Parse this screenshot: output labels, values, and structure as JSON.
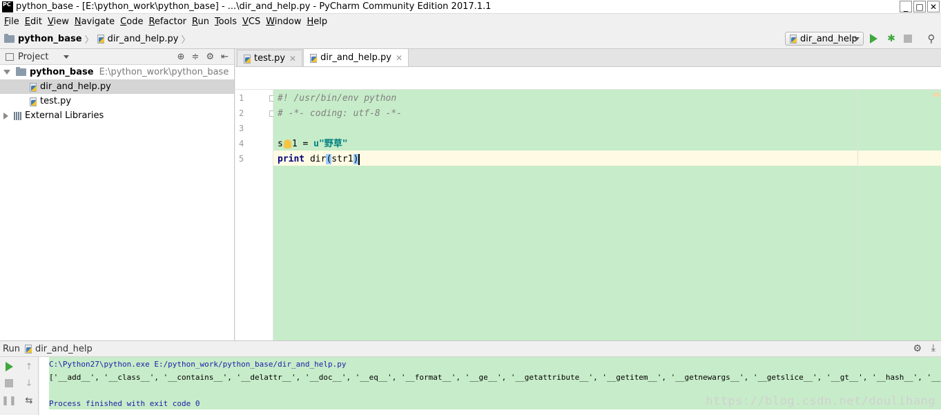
{
  "window": {
    "app_icon_text": "PC",
    "title": "python_base - [E:\\python_work\\python_base] - ...\\dir_and_help.py - PyCharm Community Edition 2017.1.1",
    "minimize": "_",
    "maximize": "□",
    "close": "✕"
  },
  "menu": {
    "items": [
      {
        "underline": "F",
        "rest": "ile"
      },
      {
        "underline": "E",
        "rest": "dit"
      },
      {
        "underline": "V",
        "rest": "iew"
      },
      {
        "underline": "N",
        "rest": "avigate"
      },
      {
        "underline": "C",
        "rest": "ode"
      },
      {
        "underline": "R",
        "rest": "efactor"
      },
      {
        "underline": "R",
        "rest": "un"
      },
      {
        "underline": "T",
        "rest": "ools"
      },
      {
        "underline": "V",
        "rest": "CS"
      },
      {
        "underline": "W",
        "rest": "indow"
      },
      {
        "underline": "H",
        "rest": "elp"
      }
    ]
  },
  "navbar": {
    "project": "python_base",
    "file": "dir_and_help.py",
    "run_config": "dir_and_help"
  },
  "project_panel": {
    "title": "Project",
    "root_name": "python_base",
    "root_path": "E:\\python_work\\python_base",
    "files": [
      "dir_and_help.py",
      "test.py"
    ],
    "external": "External Libraries"
  },
  "editor": {
    "tabs": [
      {
        "label": "test.py",
        "active": false
      },
      {
        "label": "dir_and_help.py",
        "active": true
      }
    ],
    "line_numbers": [
      "1",
      "2",
      "3",
      "4",
      "5"
    ],
    "lines": {
      "l1": "#! /usr/bin/env python",
      "l2": "# -*- coding: utf-8 -*-",
      "l4_a": "s",
      "l4_b": "1 = ",
      "l4_str": "u\"野草\"",
      "l5_kw": "print",
      "l5_fn": " dir",
      "l5_open": "(",
      "l5_arg": "str1",
      "l5_close": ")"
    }
  },
  "run_panel": {
    "label": "Run",
    "config": "dir_and_help",
    "console": {
      "cmd": "C:\\Python27\\python.exe E:/python_work/python_base/dir_and_help.py",
      "output": "['__add__', '__class__', '__contains__', '__delattr__', '__doc__', '__eq__', '__format__', '__ge__', '__getattribute__', '__getitem__', '__getnewargs__', '__getslice__', '__gt__', '__hash__', '__init__', '__le__', '_",
      "finish": "Process finished with exit code 0"
    },
    "watermark": "https://blog.csdn.net/doulihang"
  }
}
